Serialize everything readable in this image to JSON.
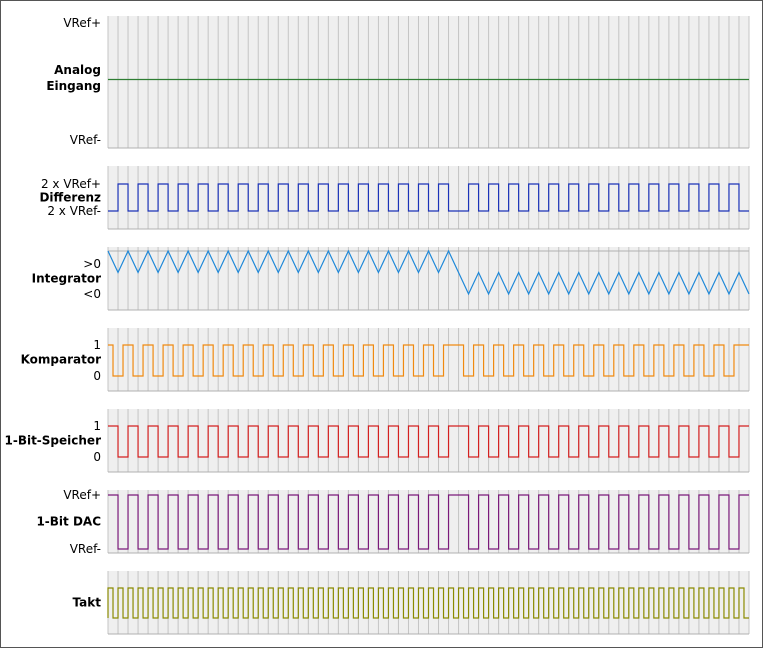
{
  "diagram": {
    "type": "sigma-delta-modulator-timing",
    "colors": {
      "panel_bg": "#efefef",
      "grid": "#c4c4c4",
      "axis": "#b0b0b0",
      "analog": "#2e7d32",
      "differenz": "#1c33b8",
      "integrator": "#1e88d8",
      "komparator": "#f08a10",
      "speicher": "#d42020",
      "dac": "#7a1a7a",
      "takt": "#8a8a00"
    },
    "rows": [
      {
        "id": "analog",
        "name": "Analog Eingang",
        "label_lines": [
          "Analog",
          "Eingang"
        ],
        "top": "VRef+",
        "bottom": "VRef-"
      },
      {
        "id": "differenz",
        "name": "Differenz",
        "label_lines": [
          "Differenz"
        ],
        "top": "2 x VRef+",
        "bottom": "2 x VRef-"
      },
      {
        "id": "integrator",
        "name": "Integrator",
        "label_lines": [
          "Integrator"
        ],
        "top": ">0",
        "bottom": "<0"
      },
      {
        "id": "komparator",
        "name": "Komparator",
        "label_lines": [
          "Komparator"
        ],
        "top": "1",
        "bottom": "0"
      },
      {
        "id": "speicher",
        "name": "1-Bit-Speicher",
        "label_lines": [
          "1-Bit-Speicher"
        ],
        "top": "1",
        "bottom": "0"
      },
      {
        "id": "dac",
        "name": "1-Bit DAC",
        "label_lines": [
          "1-Bit DAC"
        ],
        "top": "VRef+",
        "bottom": "VRef-"
      },
      {
        "id": "takt",
        "name": "Takt",
        "label_lines": [
          "Takt"
        ],
        "top": "",
        "bottom": ""
      }
    ],
    "bitstream": [
      1,
      0,
      1,
      0,
      1,
      0,
      1,
      0,
      1,
      0,
      1,
      0,
      1,
      0,
      1,
      0,
      1,
      0,
      1,
      0,
      1,
      0,
      1,
      0,
      1,
      0,
      1,
      0,
      1,
      0,
      1,
      0,
      1,
      0,
      1,
      1,
      0,
      1,
      0,
      1,
      0,
      1,
      0,
      1,
      0,
      1,
      0,
      1,
      0,
      1,
      0,
      1,
      0,
      1,
      0,
      1,
      0,
      1,
      0,
      1,
      0,
      1,
      0,
      1
    ],
    "analog_level": 0.5
  }
}
